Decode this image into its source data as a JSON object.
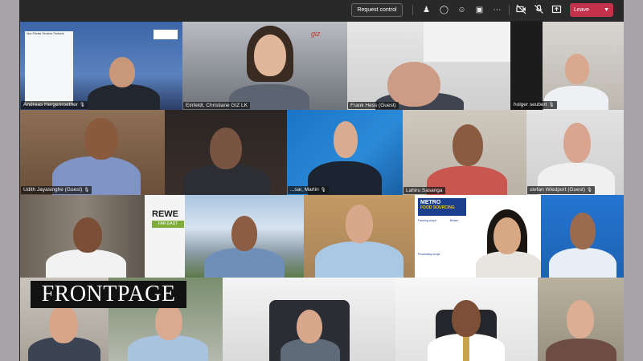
{
  "toolbar": {
    "request_control_label": "Request control",
    "leave_label": "Leave",
    "icons": [
      "people-icon",
      "chat-icon",
      "reactions-icon",
      "rooms-icon",
      "more-icon",
      "camera-off-icon",
      "mic-off-icon",
      "share-icon"
    ]
  },
  "participants": [
    {
      "name": "Andreas Hergenroether"
    },
    {
      "name": "Einfeldt, Christiane GIZ LK"
    },
    {
      "name": "Frank Hess (Guest)"
    },
    {
      "name": "holger seubert"
    },
    {
      "name": "Udith Jayasinghe (Guest)"
    },
    {
      "name": "...sar, Martin"
    },
    {
      "name": "Lahiru Sasanga"
    },
    {
      "name": "stefan Wiedport (Guest)"
    }
  ],
  "slides": {
    "rewe_top": "REWE",
    "rewe_bottom": "FAR EAST",
    "metro_top": "METRO",
    "metro_bottom": "FOOD SOURCING",
    "metro_col1": "Farming scope",
    "metro_col2": "Broker",
    "metro_col3": "Processing scope",
    "bg_text_1": "Non-Private Seminar Partners",
    "bg_text_2": "giz"
  },
  "watermark": "FRONTPAGE",
  "colors": {
    "leave": "#c4314b",
    "topbar": "#292929",
    "grid_bg": "#1f1f1f"
  }
}
